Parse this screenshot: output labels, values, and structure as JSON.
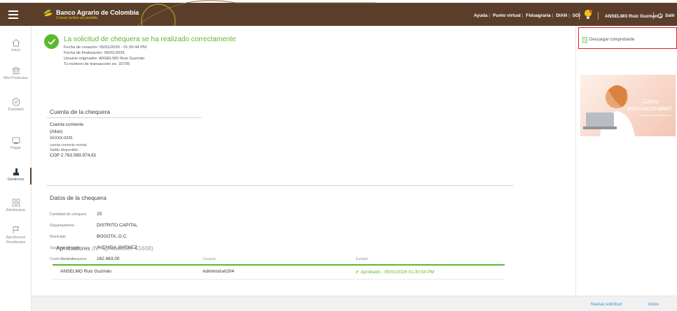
{
  "header": {
    "bank_name": "Banco Agrario de Colombia",
    "tagline": "Crecer juntos es posible",
    "links": [
      "Ayuda",
      "Punto virtual",
      "Fiduagraria",
      "DIAN",
      "SOI"
    ],
    "user": "ANSELMO Ruiz Guzmán",
    "exit_label": "Salir",
    "brand_color": "#5b3e29",
    "accent_color": "#f1c40f"
  },
  "sidebar": {
    "items": [
      {
        "label": "Inicio",
        "icon": "home-icon"
      },
      {
        "label": "Mis Productos",
        "icon": "bank-icon"
      },
      {
        "label": "Transferir",
        "icon": "transfer-icon"
      },
      {
        "label": "Pagar",
        "icon": "pay-icon"
      },
      {
        "label": "Gestionar",
        "icon": "manage-icon"
      },
      {
        "label": "Administrar",
        "icon": "grid-icon"
      },
      {
        "label": "Aprobacion Pendientes",
        "icon": "flag-icon"
      }
    ],
    "active": "Gestionar"
  },
  "success": {
    "title": "La solicitud de chequera se ha realizado correctamente",
    "lines": [
      "Fecha de creación: 05/01/2026 - 01:30:44 PM",
      "Fecha de finalización: 05/01/2026",
      "Usuario originador: ANSELMO Ruiz Guzmán",
      "Tu número de transacción es: 33705"
    ],
    "color": "#5cb82c"
  },
  "account": {
    "section_title": "Cuenta de la chequera",
    "type": "Cuenta corriente",
    "alias": "(Alias)",
    "number": "XXXXX-0225",
    "description": "cuenta corriente normal",
    "balance_label": "Saldo disponible:",
    "balance": "COP 2.763.569.974,61"
  },
  "details": {
    "section_title": "Datos de la chequera",
    "rows": [
      {
        "label": "Cantidad de cheques",
        "value": "25"
      },
      {
        "label": "Departamento",
        "value": "DISTRITO CAPITAL"
      },
      {
        "label": "Municipio",
        "value": "BOGOTA, D.C."
      },
      {
        "label": "Sucursal de retiro",
        "value": "AVENIDA JIMENEZ"
      },
      {
        "label": "Costo de la chequera",
        "value": "162.463,00"
      }
    ]
  },
  "approvers": {
    "title": "Aprobadores",
    "subtitle": "(Nº aprobación: 41608)",
    "columns": [
      "Nombre",
      "Usuario",
      "Estado"
    ],
    "rows": [
      {
        "name": "ANSELMO Ruiz Guzmán",
        "user": "Administra0204",
        "status": "Aprobado - 05/01/2026 01:30:54 PM"
      }
    ]
  },
  "right_panel": {
    "receipt_label": "Descargar comprobante",
    "promo_title_1": "¡Giros",
    "promo_title_2": "internacionales!",
    "promo_sub": "Sin costo, pensamos en ti"
  },
  "footer": {
    "new_request": "Nueva solicitud",
    "home": "Inicio"
  }
}
